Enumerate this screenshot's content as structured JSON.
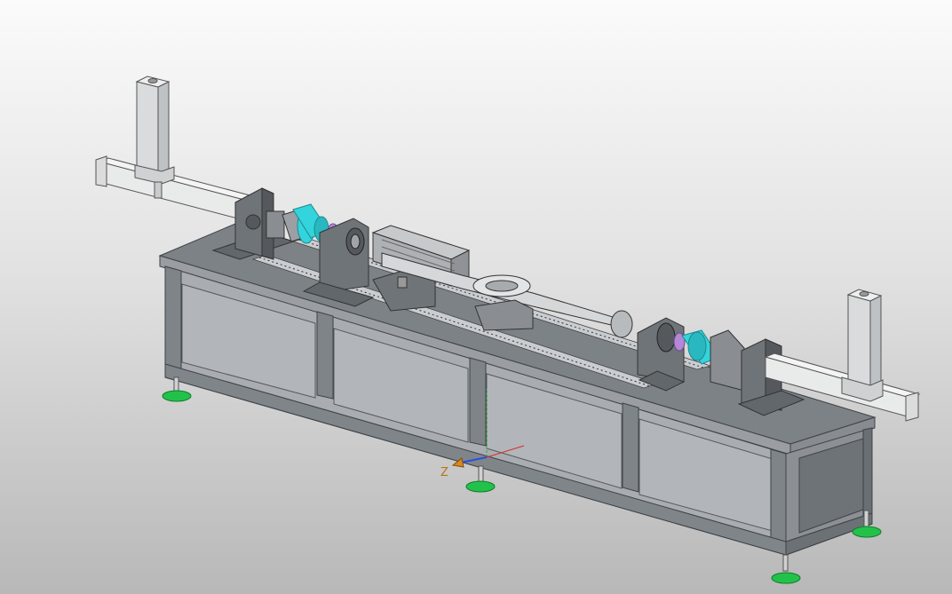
{
  "viewport": {
    "background_top": "#fbfbfb",
    "background_bottom": "#b8b8b8"
  },
  "colors": {
    "frame": "#8f9499",
    "frame_dark": "#5d6368",
    "panel": "#a7abb0",
    "deck": "#7d8287",
    "rail": "#c9ccd0",
    "beam": "#e9eaea",
    "column": "#d9dbdc",
    "bracket": "#6f7479",
    "cylinder": "#33d4dc",
    "coupling": "#b388d6",
    "fixture": "#c7c9cb",
    "foot": "#22c24a",
    "axis_x": "#d92b2b",
    "axis_y": "#2fae3a",
    "axis_z": "#2a4fe0"
  },
  "triad": {
    "z_label": "Z",
    "z_icon": "cone-icon"
  }
}
